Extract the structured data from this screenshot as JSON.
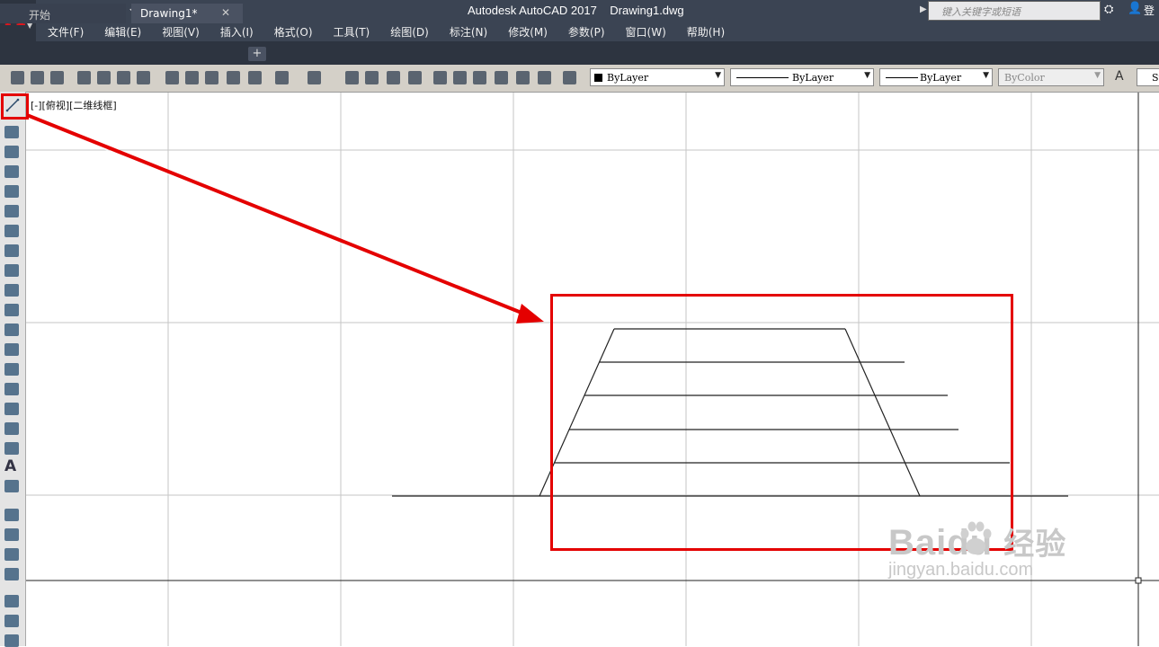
{
  "app": {
    "title": "Autodesk AutoCAD 2017",
    "document": "Drawing1.dwg"
  },
  "search": {
    "placeholder": "键入关键字或短语"
  },
  "signin": "登",
  "menus": [
    "文件(F)",
    "编辑(E)",
    "视图(V)",
    "插入(I)",
    "格式(O)",
    "工具(T)",
    "绘图(D)",
    "标注(N)",
    "修改(M)",
    "参数(P)",
    "窗口(W)",
    "帮助(H)"
  ],
  "tabs": {
    "start": "开始",
    "drawing": "Drawing1*",
    "close_glyph": "✕",
    "add_glyph": "+"
  },
  "properties": {
    "color": "ByLayer",
    "linetype": "ByLayer",
    "lineweight": "ByLayer",
    "plotstyle": "ByColor",
    "style_label": "St"
  },
  "viewport_label": "[-][俯视][二维线框]",
  "watermark": {
    "brand": "Baidu",
    "suffix": "经验",
    "url": "jingyan.baidu.com"
  },
  "annotation_colors": {
    "highlight": "#e40000"
  },
  "icons": [
    "new-icon",
    "open-icon",
    "save-icon",
    "saveas-icon",
    "print-icon",
    "undo-icon",
    "redo-icon",
    "line-icon",
    "polyline-icon",
    "polygon-icon",
    "rectangle-icon",
    "arc-icon",
    "circle-icon",
    "spline-icon",
    "ellipse-icon",
    "hatch-icon",
    "table-icon",
    "text-icon",
    "pan-icon",
    "zoom-icon",
    "help-icon",
    "binoculars-icon",
    "user-icon"
  ]
}
